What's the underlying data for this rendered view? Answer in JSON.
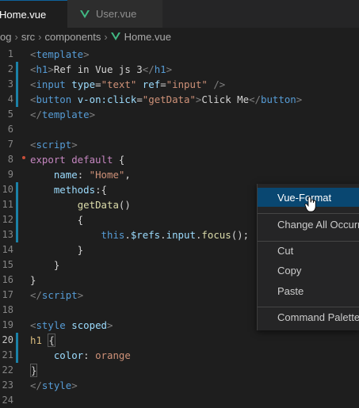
{
  "tabs": [
    {
      "label": "Home.vue",
      "active": true
    },
    {
      "label": "User.vue",
      "active": false
    }
  ],
  "breadcrumb": {
    "parts": [
      "og",
      "src",
      "components"
    ],
    "file": "Home.vue"
  },
  "editor": {
    "line_numbers": [
      "1",
      "2",
      "3",
      "4",
      "5",
      "6",
      "7",
      "8",
      "9",
      "10",
      "11",
      "12",
      "13",
      "14",
      "15",
      "16",
      "17",
      "18",
      "19",
      "20",
      "21",
      "22",
      "23",
      "24"
    ],
    "current_line": "20"
  },
  "context_menu": {
    "items": [
      "Vue-Format",
      "Change All Occurrences",
      "Cut",
      "Copy",
      "Paste",
      "Command Palette..."
    ]
  },
  "colors": {
    "accent": "#094771",
    "tag": "#569cd6",
    "attr": "#9cdcfe",
    "string": "#ce9178",
    "keyword": "#c586c0",
    "function": "#dcdcaa",
    "vue_green": "#41b883"
  },
  "icons": [
    "vue-file-icon",
    "chevron-right-icon",
    "mouse-pointer-icon"
  ]
}
